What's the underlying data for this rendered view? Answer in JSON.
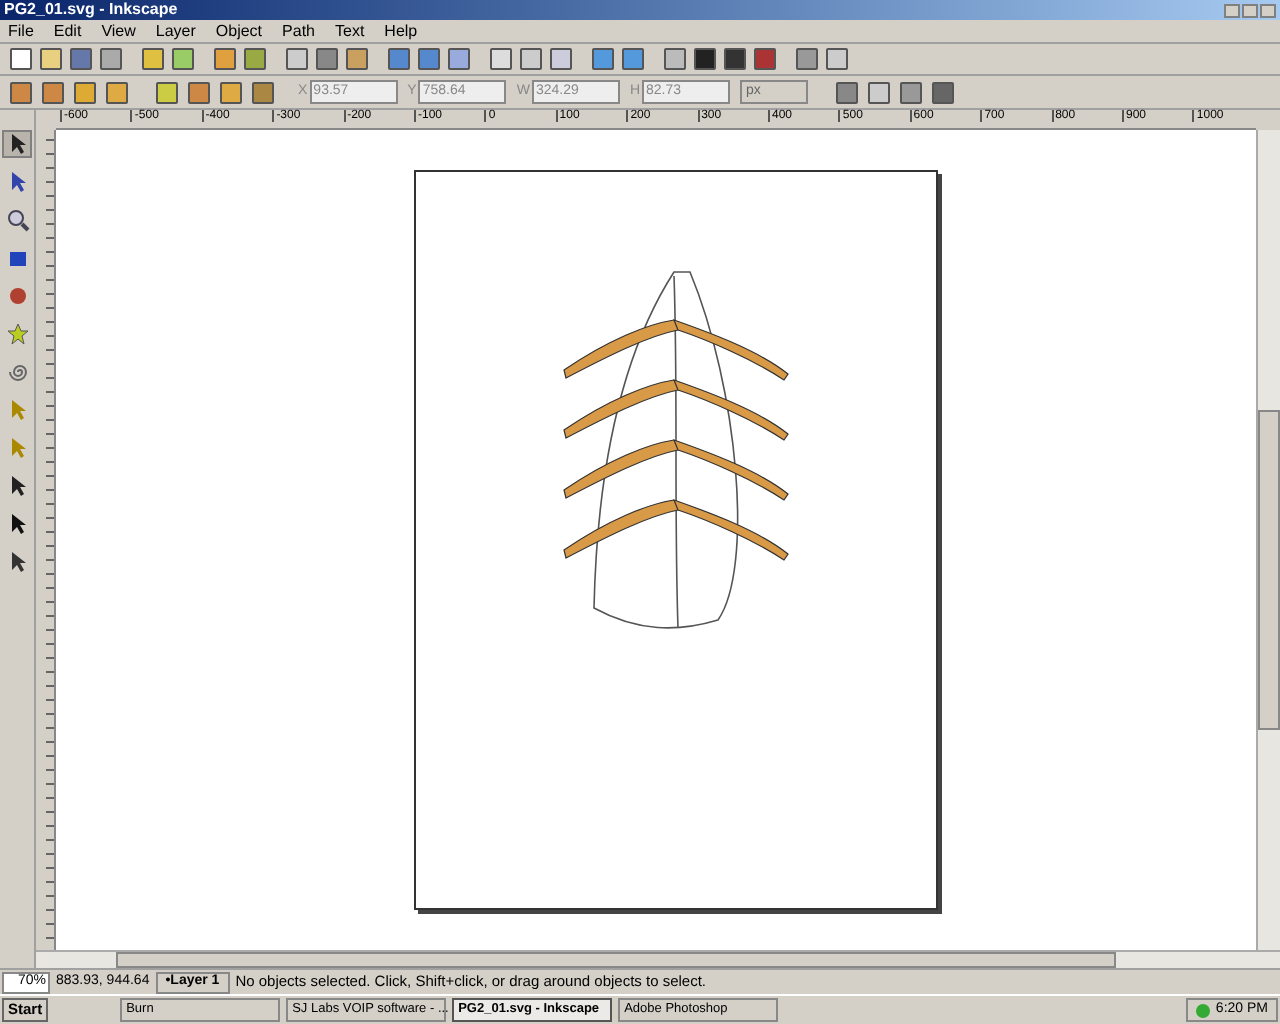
{
  "window": {
    "title": "PG2_01.svg - Inkscape"
  },
  "menu": [
    "File",
    "Edit",
    "View",
    "Layer",
    "Object",
    "Path",
    "Text",
    "Help"
  ],
  "controls": [
    {
      "label": "X",
      "value": "93.57"
    },
    {
      "label": "Y",
      "value": "758.64"
    },
    {
      "label": "W",
      "value": "324.29"
    },
    {
      "label": "H",
      "value": "82.73"
    }
  ],
  "unit": "px",
  "tools": [
    {
      "selected": true
    },
    {
      "selected": false
    },
    {
      "selected": false
    },
    {
      "selected": false
    },
    {
      "selected": false
    },
    {
      "selected": false
    },
    {
      "selected": false
    },
    {
      "selected": false
    },
    {
      "selected": false
    },
    {
      "selected": false
    },
    {
      "selected": false
    },
    {
      "selected": false
    }
  ],
  "ruler": [
    "-600",
    "-500",
    "-400",
    "-300",
    "-200",
    "-100",
    "0",
    "100",
    "200",
    "300",
    "400",
    "500",
    "600",
    "700",
    "800",
    "900",
    "1000"
  ],
  "status_bar": {
    "zoom": "70%",
    "coordinates": "883.93, 944.64",
    "layer": "•Layer 1",
    "message": "No objects selected. Click, Shift+click, or drag around objects to select."
  },
  "taskbar": {
    "start": "Start",
    "tasks": [
      {
        "label": "Burn",
        "selected": false
      },
      {
        "label": "SJ Labs VOIP software - ...",
        "selected": false
      },
      {
        "label": "PG2_01.svg - Inkscape",
        "selected": true
      },
      {
        "label": "Adobe Photoshop",
        "selected": false
      }
    ],
    "clock": "6:20 PM"
  }
}
